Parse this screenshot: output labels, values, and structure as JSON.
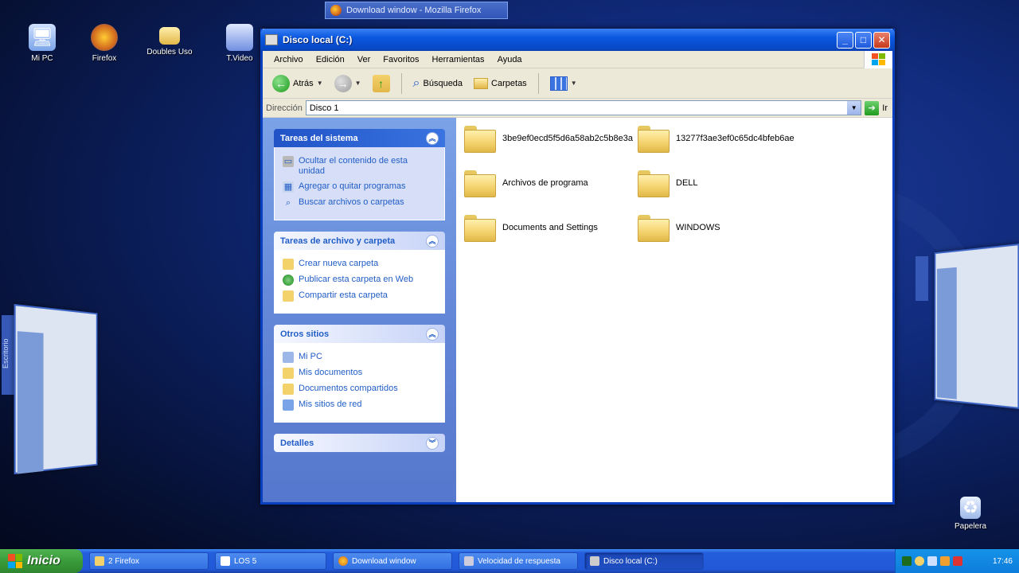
{
  "top_tab": {
    "label": "Download window - Mozilla Firefox"
  },
  "desktop_icons": [
    {
      "label": "Mi PC",
      "icon": "my-computer-icon"
    },
    {
      "label": "Firefox",
      "icon": "firefox-icon"
    },
    {
      "label": "Doubles Uso",
      "icon": "folder-icon"
    },
    {
      "label": "T.Video",
      "icon": "video-icon"
    },
    {
      "label": "Papelera",
      "icon": "recycle-bin-icon"
    }
  ],
  "side_left_label": "Escritorio",
  "window": {
    "title": "Disco local (C:)",
    "menu": [
      "Archivo",
      "Edición",
      "Ver",
      "Favoritos",
      "Herramientas",
      "Ayuda"
    ],
    "toolbar": {
      "back": "Atrás",
      "search": "Búsqueda",
      "folders": "Carpetas"
    },
    "address": {
      "label": "Dirección",
      "value": "Disco 1",
      "go": "Ir"
    },
    "panels": [
      {
        "title": "Tareas del sistema",
        "style": "dark",
        "items": [
          {
            "label": "Ocultar el contenido de esta unidad",
            "icon": "drive-icon"
          },
          {
            "label": "Agregar o quitar programas",
            "icon": "programs-icon"
          },
          {
            "label": "Buscar archivos o carpetas",
            "icon": "search-icon"
          }
        ]
      },
      {
        "title": "Tareas de archivo y carpeta",
        "style": "light",
        "items": [
          {
            "label": "Crear nueva carpeta",
            "icon": "new-folder-icon"
          },
          {
            "label": "Publicar esta carpeta en Web",
            "icon": "globe-icon"
          },
          {
            "label": "Compartir esta carpeta",
            "icon": "share-icon"
          }
        ]
      },
      {
        "title": "Otros sitios",
        "style": "light",
        "items": [
          {
            "label": "Mi PC",
            "icon": "my-computer-icon"
          },
          {
            "label": "Mis documentos",
            "icon": "documents-icon"
          },
          {
            "label": "Documentos compartidos",
            "icon": "shared-folder-icon"
          },
          {
            "label": "Mis sitios de red",
            "icon": "network-icon"
          }
        ]
      },
      {
        "title": "Detalles",
        "style": "light",
        "items": []
      }
    ],
    "folders": [
      "3be9ef0ecd5f5d6a58ab2c5b8e3a",
      "13277f3ae3ef0c65dc4bfeb6ae",
      "Archivos de programa",
      "DELL",
      "Documents and Settings",
      "WINDOWS"
    ]
  },
  "taskbar": {
    "start": "Inicio",
    "tasks": [
      "2 Firefox",
      "LOS 5",
      "Download window",
      "Velocidad de respuesta",
      "Disco local (C:)"
    ],
    "clock": "17:46"
  }
}
